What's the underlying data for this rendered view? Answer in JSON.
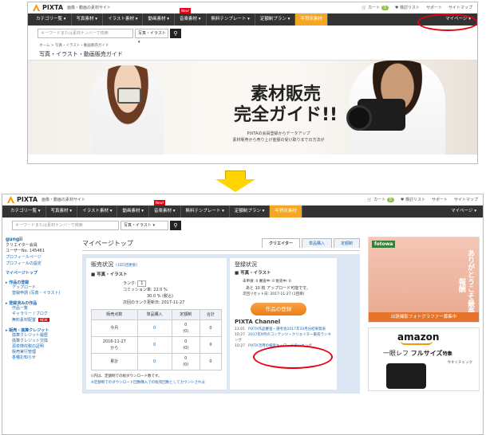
{
  "top": {
    "logo": "PIXTA",
    "tagline": "画像・動画の素材サイト",
    "links": [
      "カート",
      "検討リスト",
      "サポート",
      "サイトマップ"
    ],
    "cart_count": "0"
  },
  "nav": {
    "items": [
      "カテゴリ一覧",
      "写真素材",
      "イラスト素材",
      "動画素材",
      "音楽素材",
      "無料テンプレート",
      "定額制プラン",
      "年賀状素材"
    ],
    "new_tag": "New!",
    "mypage": "マイページ"
  },
  "search": {
    "placeholder": "キーワードまたは素材ナンバーで検索",
    "select": "写真・イラスト",
    "button_icon": "search-icon"
  },
  "shot1": {
    "breadcrumb": "ホーム > 写真・イラスト・動画販売ガイド",
    "page_title": "写真・イラスト・動画販売ガイド",
    "banner_title_1": "素材販売",
    "banner_title_2": "完全ガイド!!",
    "banner_sub_1": "PIXTAの会員登録からデータアップ",
    "banner_sub_2": "素材販売から売り上げ金額の受け取りまでの方法が"
  },
  "shot2": {
    "sidebar": {
      "user": "gungii",
      "role": "クリエイター会員",
      "userno": "ユーザーNo. 145461",
      "links": [
        "プロフィールページ",
        "プロフィールの設定"
      ],
      "top": "マイページトップ",
      "sections": [
        {
          "title": "作品の登録",
          "items": [
            "アップロード",
            "登録申請 (写真・イラスト)"
          ]
        },
        {
          "title": "登録済みの作品",
          "items": [
            "作品一覧",
            "ギャラリー / ブログ",
            "無料素材配置"
          ]
        },
        {
          "title": "販売・換算クレジット",
          "items": [
            "換算クレジット履歴",
            "換算クレジット交換",
            "源泉徴収税の証明",
            "販売実行管理",
            "各種お知らせ"
          ]
        }
      ],
      "new_badge": "NEW"
    },
    "title": "マイページトップ",
    "tabs": [
      "クリエイター",
      "単品購入",
      "定額制"
    ],
    "sales": {
      "title": "販売状況",
      "update_link": "(1日1回更新)",
      "section": "写真・イラスト",
      "rank_label": "ランク:",
      "rank": "1",
      "commission_label": "コミッション率:",
      "commission": "22.0 %",
      "commission_tax": "30.0 % (税込)",
      "next_update": "次回のランク更新日: 2017-11-27",
      "table_head": [
        "販売点数",
        "単品購入",
        "定額制",
        "合計"
      ],
      "rows": [
        [
          "今月",
          "0",
          "0\n(0)",
          "0"
        ],
        [
          "2016-11-27\nから",
          "0",
          "0\n(0)",
          "0"
        ],
        [
          "累計",
          "0",
          "0\n(0)",
          "0"
        ]
      ],
      "note_1": "()内は、定額制での総ダウンロード数です。",
      "note_2": "※定額制でのダウンロード回数購入での販売回数としてカウントされま"
    },
    "reg": {
      "title": "登録状況",
      "section": "写真・イラスト",
      "status": "未申請: 0   審査中: 0   販売中: 0",
      "remaining": "あと 10 枚 アップロード可能です。",
      "reset": "次回リセット日: 2017-11-27 (1回目)",
      "button": "作品の登録"
    },
    "channel": {
      "title": "PIXTA Channel",
      "news": [
        {
          "date": "11:01",
          "text": "PIXTA作品審査・選考会2017年10月分結果発表"
        },
        {
          "date": "10:27",
          "text": "2017年9月のコンテンツ・クリエイター販売ランキング"
        },
        {
          "date": "10:27",
          "text": "PIXTA活用の検索キーワードランキング"
        }
      ]
    },
    "ad1": {
      "brand": "fotowa",
      "text": "ありがとうこそ最高の報酬",
      "bar": "出張撮影フォトグラファー募集中"
    },
    "ad2": {
      "brand": "amazon",
      "text_a": "一眼レフ",
      "text_b": "フルサイズ",
      "text_c": "特集",
      "small": "今すぐチェック"
    }
  }
}
